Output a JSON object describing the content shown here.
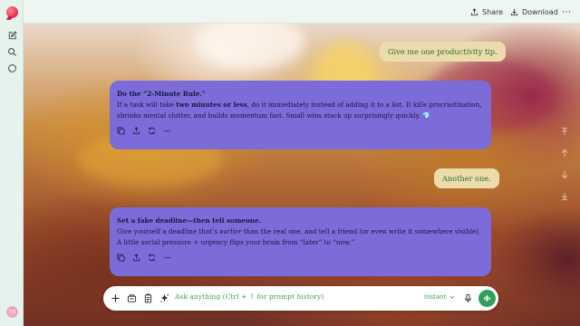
{
  "sidebar": {
    "logo": "chat-logo",
    "icons": [
      "new-chat-icon",
      "search-icon",
      "chat-bubble-icon"
    ],
    "avatar_initials": "TH"
  },
  "header": {
    "share_label": "Share",
    "download_label": "Download",
    "more_label": "⋯"
  },
  "conversation": {
    "messages": [
      {
        "role": "user",
        "text": "Give me one productivity tip."
      },
      {
        "role": "assistant",
        "title": "Do the “2-Minute Rule.”",
        "p1_before": "If a task will take ",
        "p1_bold": "two minutes or less",
        "p1_after": ", do it immediately instead of adding it to a list. It kills procrastination,",
        "p2": "shrinks mental clutter, and builds momentum fast. Small wins stack up surprisingly quickly. 💎"
      },
      {
        "role": "user",
        "text": "Another one."
      },
      {
        "role": "assistant",
        "title": "Set a fake deadline—then tell someone.",
        "p1_before": "Give yourself a deadline that’s ",
        "p1_italic": "earlier",
        "p1_after": " than the real one, and tell a friend (or even write it somewhere visible).",
        "p2": "A little social pressure + urgency flips your brain from “later” to “now.”"
      }
    ],
    "message_actions": [
      "copy-icon",
      "share-icon",
      "regenerate-icon",
      "more-icon"
    ]
  },
  "composer": {
    "placeholder": "Ask anything (Ctrl + ↑ for prompt history)",
    "mode": "Instant",
    "tools": [
      "plus-icon",
      "attachment-icon",
      "clipboard-icon",
      "sparkle-icon"
    ]
  },
  "colors": {
    "assistant_bubble": "#7b6cd9",
    "user_bubble": "#ecdcab",
    "accent": "#2f9f5a"
  }
}
